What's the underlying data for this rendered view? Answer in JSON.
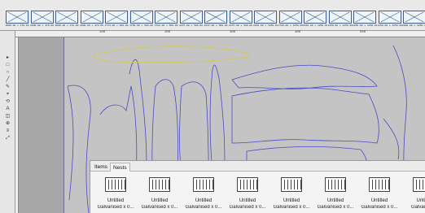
{
  "thumbnails": [
    {
      "caption": "2000.00 x 470.00"
    },
    {
      "caption": "2000.00 x 470.00"
    },
    {
      "caption": "2000.00 x 470.00"
    },
    {
      "caption": "2000.00 x 470.00"
    },
    {
      "caption": "1774.00 x 500.00"
    },
    {
      "caption": "1760.00 x 500.00"
    },
    {
      "caption": "1781.00 x 500.00"
    },
    {
      "caption": "2237.00 x 500.00"
    },
    {
      "caption": "2237.00 x 500.00"
    },
    {
      "caption": "2237.00 x 500.00"
    },
    {
      "caption": "2240.00 x 1250.00"
    },
    {
      "caption": "1780.00 x 1250.00"
    },
    {
      "caption": "2240.00 x 1250.00"
    },
    {
      "caption": "1250.00 x 1250.00"
    },
    {
      "caption": "1250.00 x 1250.00"
    },
    {
      "caption": "1250.00 x 1250.00"
    },
    {
      "caption": "2000.00 x 1250.00"
    }
  ],
  "ruler": {
    "labels": [
      "100",
      "200",
      "300",
      "400",
      "500"
    ]
  },
  "palette": {
    "tools": [
      "▸",
      "□",
      "○",
      "╱",
      "✎",
      "⌖",
      "⟲",
      "A",
      "◫",
      "⊕",
      "≡",
      "⤢"
    ]
  },
  "panel": {
    "tabs": [
      {
        "label": "Items"
      },
      {
        "label": "Nests"
      }
    ],
    "active_tab": "Nests",
    "nests": [
      {
        "title": "Untitled",
        "subtitle": "Galvanised x 0..."
      },
      {
        "title": "Untitled",
        "subtitle": "Galvanised x 0..."
      },
      {
        "title": "Untitled",
        "subtitle": "Galvanised x 0..."
      },
      {
        "title": "Untitled",
        "subtitle": "Galvanised x 0..."
      },
      {
        "title": "Untitled",
        "subtitle": "Galvanised x 0..."
      },
      {
        "title": "Untitled",
        "subtitle": "Galvanised x 0..."
      },
      {
        "title": "Untitled",
        "subtitle": "Galvanised x 0..."
      },
      {
        "title": "Untitle",
        "subtitle": "Galvanised"
      }
    ]
  },
  "colors": {
    "part_outline": "#4a4ac8",
    "selected_outline": "#d2c85a",
    "sheet": "#c4c4c4"
  }
}
